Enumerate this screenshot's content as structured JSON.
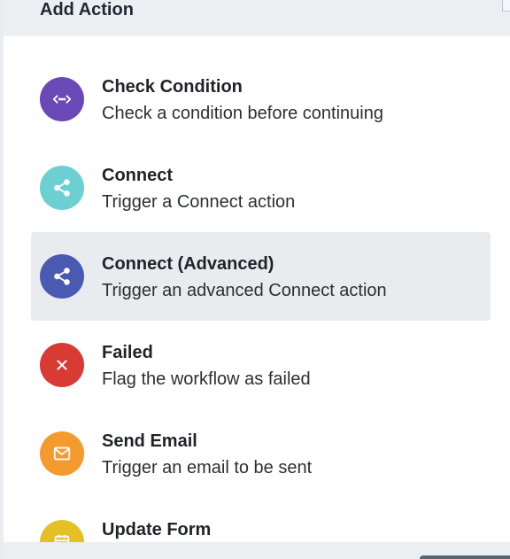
{
  "header": {
    "title": "Add Action"
  },
  "actions": [
    {
      "title": "Check Condition",
      "description": "Check a condition before continuing",
      "icon": "code-arrows-icon",
      "color": "#6b48b8"
    },
    {
      "title": "Connect",
      "description": "Trigger a Connect action",
      "icon": "share-icon",
      "color": "#6ccfd1"
    },
    {
      "title": "Connect (Advanced)",
      "description": "Trigger an advanced Connect action",
      "icon": "share-icon",
      "color": "#4a5ab3",
      "highlighted": true
    },
    {
      "title": "Failed",
      "description": "Flag the workflow as failed",
      "icon": "close-icon",
      "color": "#d83b33"
    },
    {
      "title": "Send Email",
      "description": "Trigger an email to be sent",
      "icon": "mail-icon",
      "color": "#f59a2e"
    },
    {
      "title": "Update Form",
      "description": "",
      "icon": "calendar-icon",
      "color": "#e5c025"
    }
  ]
}
